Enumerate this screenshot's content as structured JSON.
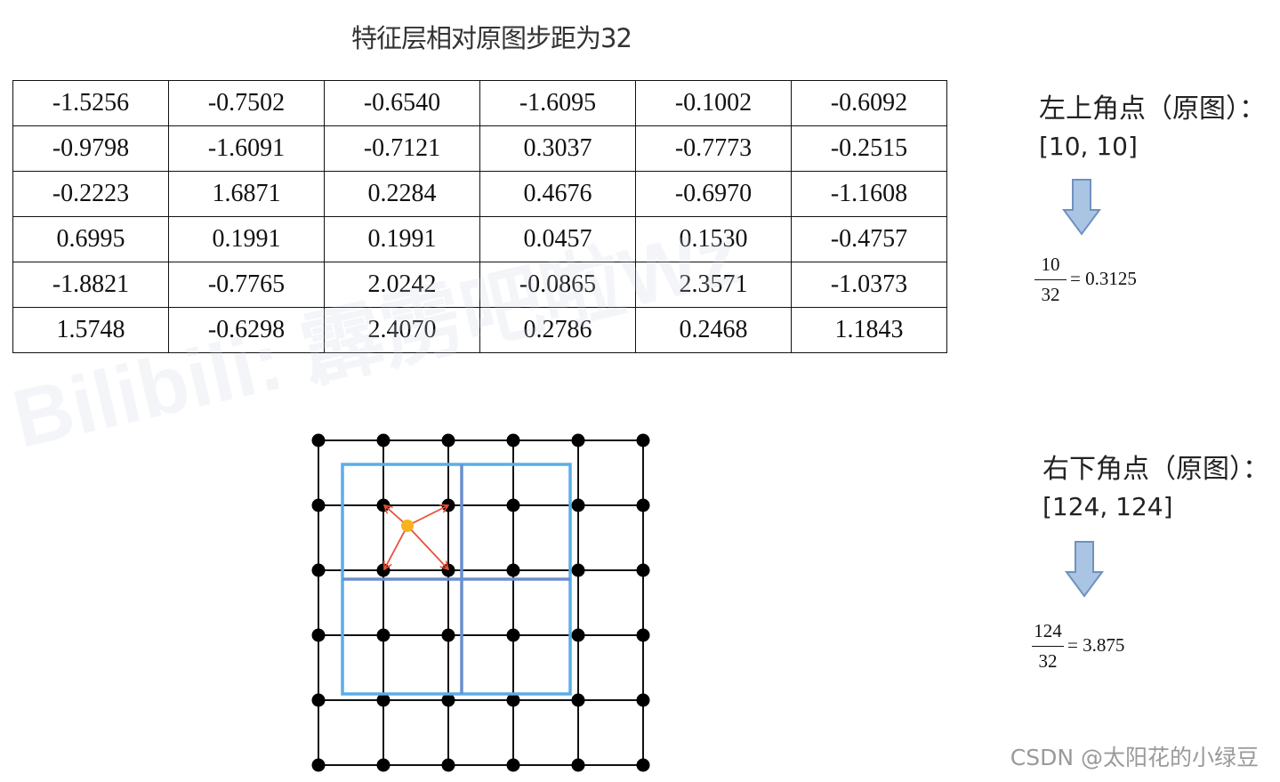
{
  "title": "特征层相对原图步距为32",
  "feature_map": [
    [
      "-1.5256",
      "-0.7502",
      "-0.6540",
      "-1.6095",
      "-0.1002",
      "-0.6092"
    ],
    [
      "-0.9798",
      "-1.6091",
      "-0.7121",
      "0.3037",
      "-0.7773",
      "-0.2515"
    ],
    [
      "-0.2223",
      "1.6871",
      "0.2284",
      "0.4676",
      "-0.6970",
      "-1.1608"
    ],
    [
      "0.6995",
      "0.1991",
      "0.1991",
      "0.0457",
      "0.1530",
      "-0.4757"
    ],
    [
      "-1.8821",
      "-0.7765",
      "2.0242",
      "-0.0865",
      "2.3571",
      "-1.0373"
    ],
    [
      "1.5748",
      "-0.6298",
      "2.4070",
      "0.2786",
      "0.2468",
      "1.1843"
    ]
  ],
  "top_left": {
    "label": "左上角点（原图）：",
    "coord": "[10, 10]",
    "numerator": "10",
    "denominator": "32",
    "result": "= 0.3125"
  },
  "bottom_right": {
    "label": "右下角点（原图）：",
    "coord": "[124, 124]",
    "numerator": "124",
    "denominator": "32",
    "result": "= 3.875"
  },
  "watermark": "Bilibili: 霹雳吧啦Wz",
  "credit": "CSDN @太阳花的小绿豆",
  "colors": {
    "arrow_fill": "#aac4e4",
    "arrow_stroke": "#6f91bf",
    "roi_light": "#5aaee8",
    "roi_dark": "#6a8fd0",
    "sample_arrow": "#e8503a",
    "sample_point": "#f7b21c"
  }
}
